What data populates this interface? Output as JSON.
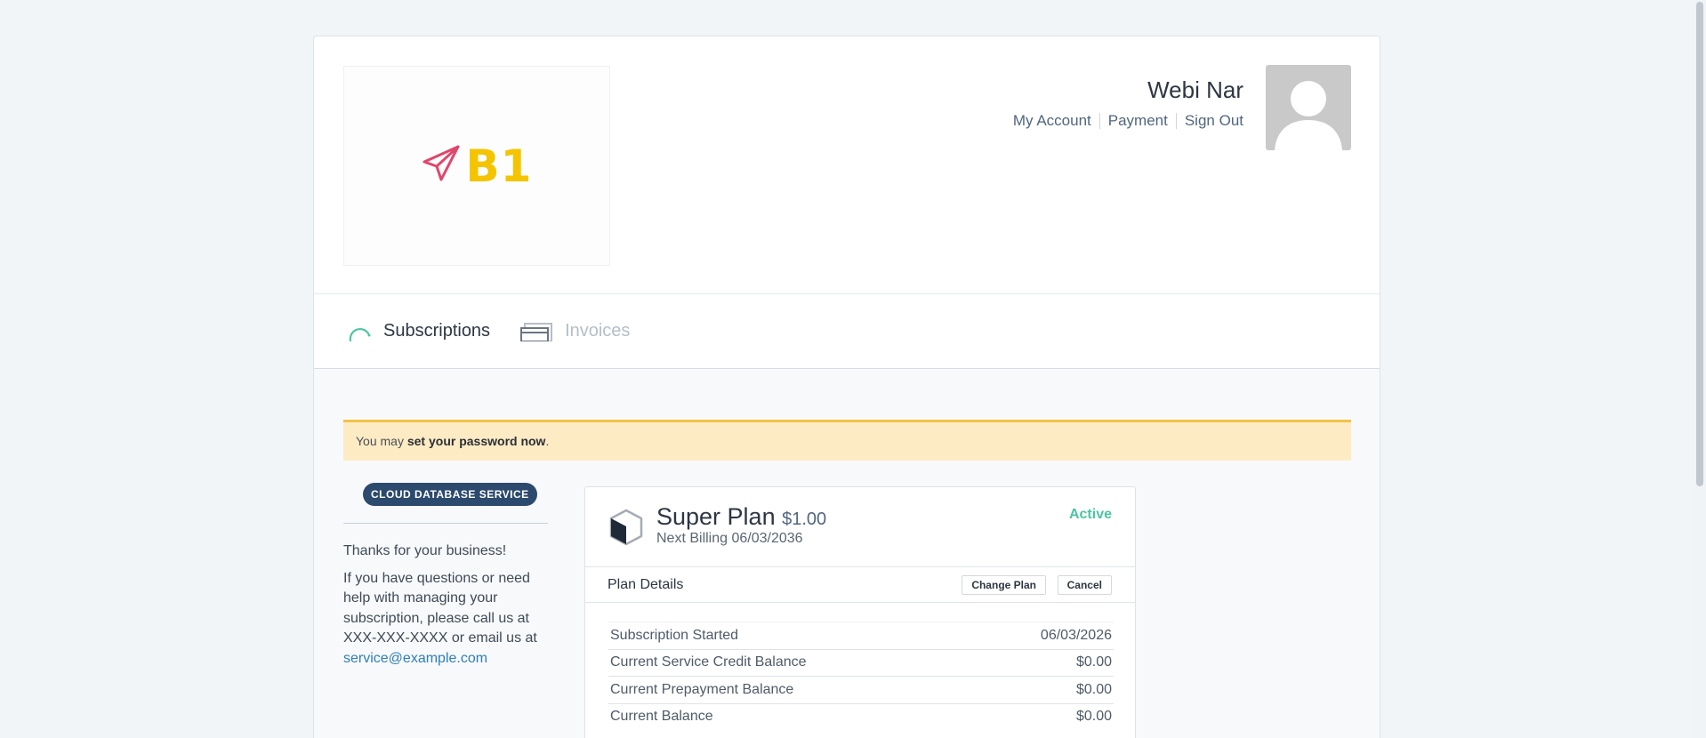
{
  "brand": {
    "logo_text": "B1"
  },
  "user": {
    "name": "Webi Nar",
    "links": [
      "My Account",
      "Payment",
      "Sign Out"
    ]
  },
  "tabs": [
    {
      "label": "Subscriptions",
      "active": true
    },
    {
      "label": "Invoices",
      "active": false
    }
  ],
  "alert": {
    "prefix": "You may ",
    "bold": "set your password now",
    "suffix": "."
  },
  "sidebar": {
    "badge": "CLOUD DATABASE SERVICE",
    "thanks": "Thanks for your business!",
    "help_text": "If you have questions or need help with managing your subscription, please call us at XXX-XXX-XXXX or email us at",
    "email": "service@example.com"
  },
  "plan": {
    "name": "Super Plan",
    "price": "$1.00",
    "next_billing": "Next Billing 06/03/2036",
    "status": "Active",
    "details_label": "Plan Details",
    "change_label": "Change Plan",
    "cancel_label": "Cancel",
    "rows": [
      {
        "label": "Subscription Started",
        "value": "06/03/2026"
      },
      {
        "label": "Current Service Credit Balance",
        "value": "$0.00"
      },
      {
        "label": "Current Prepayment Balance",
        "value": "$0.00"
      },
      {
        "label": "Current Balance",
        "value": "$0.00"
      }
    ]
  },
  "colors": {
    "accent_teal": "#4cc5a2",
    "badge_navy": "#2c4a6e",
    "alert_bg": "#fdebc4",
    "logo_yellow": "#f5c400",
    "logo_pink": "#e0476b"
  },
  "icons": {
    "logo": "paper-plane-icon",
    "subscriptions_tab": "arc-icon",
    "invoices_tab": "invoices-icon",
    "plan": "cube-icon",
    "avatar": "user-silhouette-icon"
  }
}
